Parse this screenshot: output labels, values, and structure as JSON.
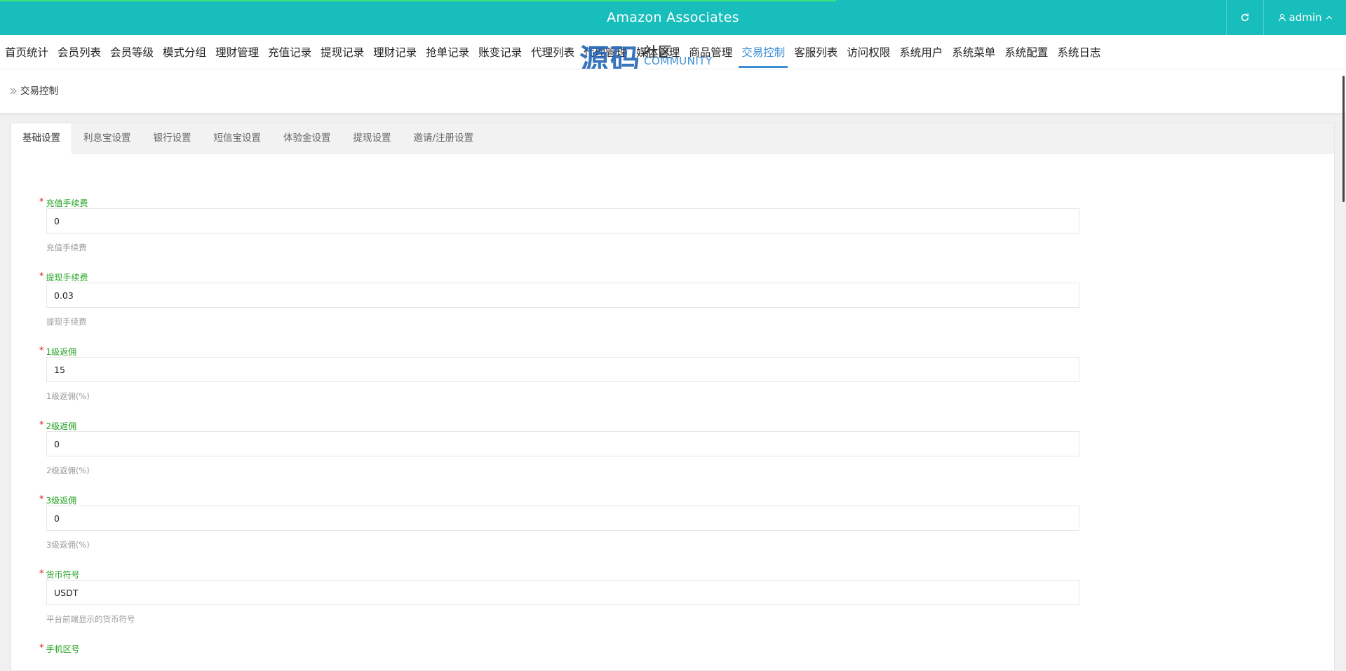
{
  "header": {
    "title": "Amazon Associates",
    "user": "admin",
    "bg_color": "#17bebb"
  },
  "nav": {
    "items": [
      {
        "label": "首页统计"
      },
      {
        "label": "会员列表"
      },
      {
        "label": "会员等级"
      },
      {
        "label": "模式分组"
      },
      {
        "label": "理财管理"
      },
      {
        "label": "充值记录"
      },
      {
        "label": "提现记录"
      },
      {
        "label": "理财记录"
      },
      {
        "label": "抢单记录"
      },
      {
        "label": "账变记录"
      },
      {
        "label": "代理列表"
      },
      {
        "label": "代理管理"
      },
      {
        "label": "媒体管理"
      },
      {
        "label": "商品管理"
      },
      {
        "label": "交易控制",
        "active": true
      },
      {
        "label": "客服列表"
      },
      {
        "label": "访问权限"
      },
      {
        "label": "系统用户"
      },
      {
        "label": "系统菜单"
      },
      {
        "label": "系统配置"
      },
      {
        "label": "系统日志"
      }
    ],
    "active_color": "#3d8fd8"
  },
  "breadcrumb": {
    "current": "交易控制"
  },
  "tabs": [
    {
      "label": "基础设置",
      "active": true
    },
    {
      "label": "利息宝设置"
    },
    {
      "label": "银行设置"
    },
    {
      "label": "短信宝设置"
    },
    {
      "label": "体验金设置"
    },
    {
      "label": "提现设置"
    },
    {
      "label": "邀请/注册设置"
    }
  ],
  "form": {
    "fields": [
      {
        "label": "充值手续费",
        "value": "0",
        "help": "充值手续费"
      },
      {
        "label": "提现手续费",
        "value": "0.03",
        "help": "提现手续费"
      },
      {
        "label": "1级返佣",
        "value": "15",
        "help": "1级返佣(%)"
      },
      {
        "label": "2级返佣",
        "value": "0",
        "help": "2级返佣(%)"
      },
      {
        "label": "3级返佣",
        "value": "0",
        "help": "3级返佣(%)"
      },
      {
        "label": "货币符号",
        "value": "USDT",
        "help": "平台前端显示的货币符号"
      },
      {
        "label": "手机区号",
        "value": "",
        "help": ""
      }
    ],
    "label_color": "#23a323",
    "required_color": "#e02020"
  },
  "watermark": {
    "big": "源码",
    "side": "社区",
    "community": "COMMUNITY",
    "url": "www.shequym.com"
  }
}
